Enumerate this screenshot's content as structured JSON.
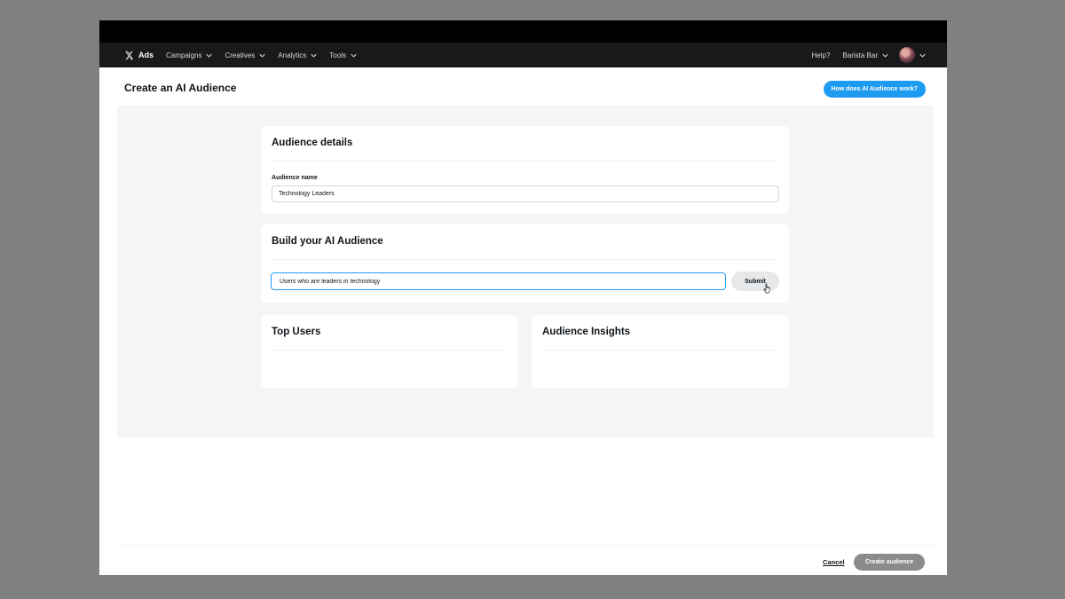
{
  "nav": {
    "brand_label": "Ads",
    "items": [
      {
        "label": "Campaigns"
      },
      {
        "label": "Creatives"
      },
      {
        "label": "Analytics"
      },
      {
        "label": "Tools"
      }
    ],
    "help_label": "Help?",
    "account_name": "Barista Bar",
    "icons": {
      "logo": "x-logo-icon",
      "dropdown": "chevron-down-icon",
      "avatar": "avatar"
    }
  },
  "header": {
    "title": "Create an AI Audience",
    "help_button": "How does AI Audience work?"
  },
  "audience_details": {
    "title": "Audience details",
    "name_label": "Audience name",
    "name_value": "Technology Leaders"
  },
  "build": {
    "title": "Build your AI Audience",
    "prompt_value": "Users who are leaders in technology",
    "submit_label": "Submit"
  },
  "top_users": {
    "title": "Top Users"
  },
  "insights": {
    "title": "Audience Insights"
  },
  "footer": {
    "cancel_label": "Cancel",
    "create_label": "Create audience"
  },
  "colors": {
    "accent": "#1d9bf0",
    "navbar": "#18191b",
    "content_bg": "#f4f5f5",
    "disabled_button": "#8b8b8b"
  }
}
